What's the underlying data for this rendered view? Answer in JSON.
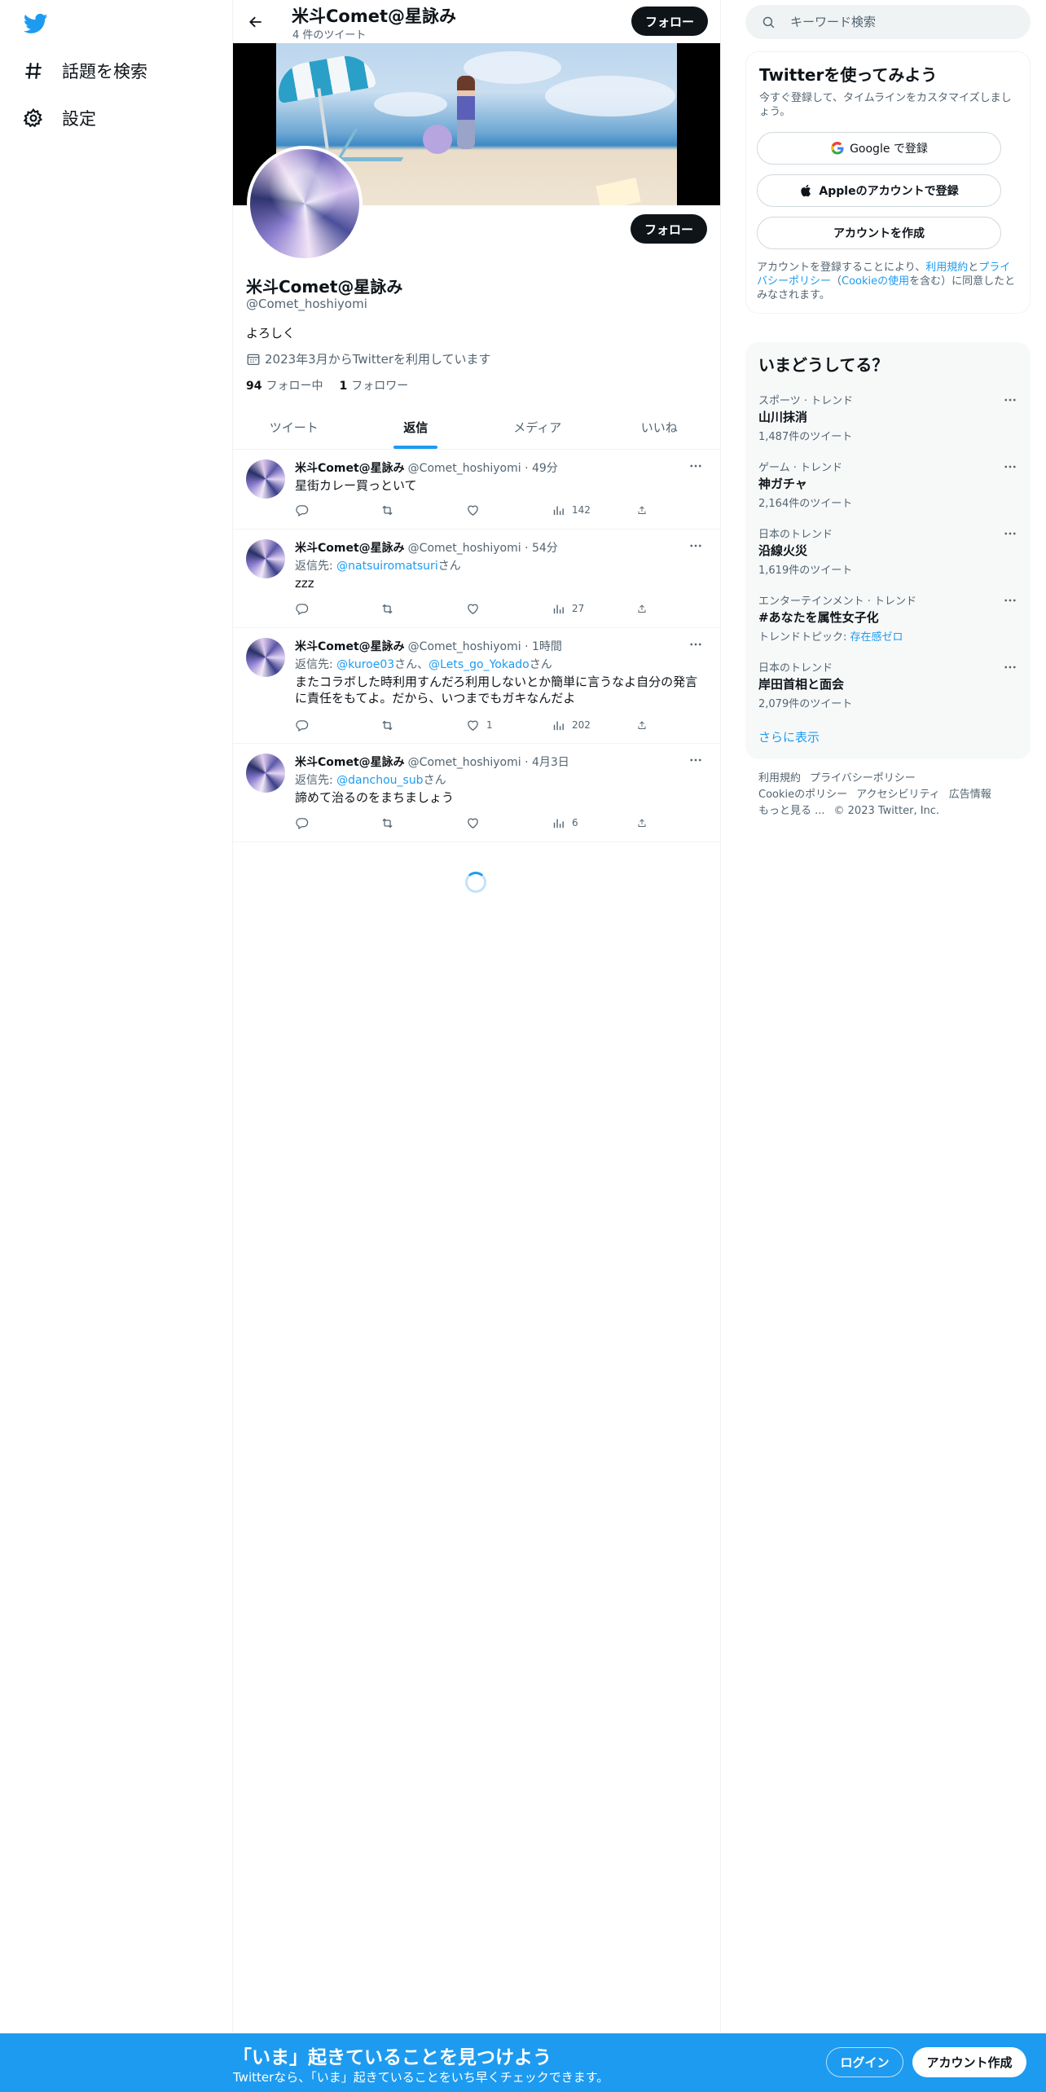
{
  "colors": {
    "accent": "#1d9bf0",
    "text": "#0f1419",
    "muted": "#536471",
    "border": "#eff3f4"
  },
  "left_nav": {
    "logo_icon": "twitter-bird-icon",
    "items": [
      {
        "label": "話題を検索",
        "icon": "hashtag-icon"
      },
      {
        "label": "設定",
        "icon": "gear-icon"
      }
    ]
  },
  "header": {
    "name": "米斗Comet@星詠み",
    "tweet_count": "4 件のツイート",
    "follow_label": "フォロー"
  },
  "profile": {
    "name": "米斗Comet@星詠み",
    "handle": "@Comet_hoshiyomi",
    "bio": "よろしく",
    "joined": "2023年3月からTwitterを利用しています",
    "following_count": "94",
    "following_label": "フォロー中",
    "followers_count": "1",
    "followers_label": "フォロワー",
    "follow_label": "フォロー"
  },
  "tabs": [
    "ツイート",
    "返信",
    "メディア",
    "いいね"
  ],
  "active_tab": "返信",
  "tweets": [
    {
      "name": "米斗Comet@星詠み",
      "meta": "@Comet_hoshiyomi · 49分",
      "reply_prefix": "",
      "reply_to": [],
      "reply_suffix": "",
      "text": "星街カレー買っといて",
      "likes": "",
      "views": "142"
    },
    {
      "name": "米斗Comet@星詠み",
      "meta": "@Comet_hoshiyomi · 54分",
      "reply_prefix": "返信先: ",
      "reply_to": [
        "@natsuiromatsuri"
      ],
      "reply_suffix": "さん",
      "text": "zzz",
      "likes": "",
      "views": "27"
    },
    {
      "name": "米斗Comet@星詠み",
      "meta": "@Comet_hoshiyomi · 1時間",
      "reply_prefix": "返信先: ",
      "reply_to": [
        "@kuroe03",
        "@Lets_go_Yokado"
      ],
      "reply_mid": "さん、",
      "reply_suffix": "さん",
      "text": "またコラボした時利用すんだろ利用しないとか簡単に言うなよ自分の発言に責任をもてよ。だから、いつまでもガキなんだよ",
      "likes": "1",
      "views": "202"
    },
    {
      "name": "米斗Comet@星詠み",
      "meta": "@Comet_hoshiyomi · 4月3日",
      "reply_prefix": "返信先: ",
      "reply_to": [
        "@danchou_sub"
      ],
      "reply_suffix": "さん",
      "text": "諦めて治るのをまちましょう",
      "likes": "",
      "views": "6"
    }
  ],
  "search": {
    "placeholder": "キーワード検索"
  },
  "signup": {
    "title": "Twitterを使ってみよう",
    "desc": "今すぐ登録して、タイムラインをカスタマイズしましょう。",
    "google": "Google で登録",
    "apple": "Appleのアカウントで登録",
    "create": "アカウントを作成",
    "legal_1": "アカウントを登録することにより、",
    "legal_terms": "利用規約",
    "legal_2": "と",
    "legal_privacy": "プライバシーポリシー",
    "legal_3": "（",
    "legal_cookie": "Cookieの使用",
    "legal_4": "を含む）に同意したとみなされます。"
  },
  "trends": {
    "title": "いまどうしてる？",
    "items": [
      {
        "category": "スポーツ · トレンド",
        "name": "山川抹消",
        "count": "1,487件のツイート"
      },
      {
        "category": "ゲーム · トレンド",
        "name": "神ガチャ",
        "count": "2,164件のツイート"
      },
      {
        "category": "日本のトレンド",
        "name": "沿線火災",
        "count": "1,619件のツイート"
      },
      {
        "category": "エンターテインメント · トレンド",
        "name": "#あなたを属性女子化",
        "count_prefix": "トレンドトピック: ",
        "count_link": "存在感ゼロ"
      },
      {
        "category": "日本のトレンド",
        "name": "岸田首相と面会",
        "count": "2,079件のツイート"
      }
    ],
    "show_more": "さらに表示"
  },
  "footer": {
    "links": [
      "利用規約",
      "プライバシーポリシー",
      "Cookieのポリシー",
      "アクセシビリティ",
      "広告情報",
      "もっと見る ..."
    ],
    "copyright": "© 2023 Twitter, Inc."
  },
  "bottom_bar": {
    "title": "「いま」起きていることを見つけよう",
    "subtitle": "Twitterなら、「いま」起きていることをいち早くチェックできます。",
    "login": "ログイン",
    "signup": "アカウント作成"
  }
}
